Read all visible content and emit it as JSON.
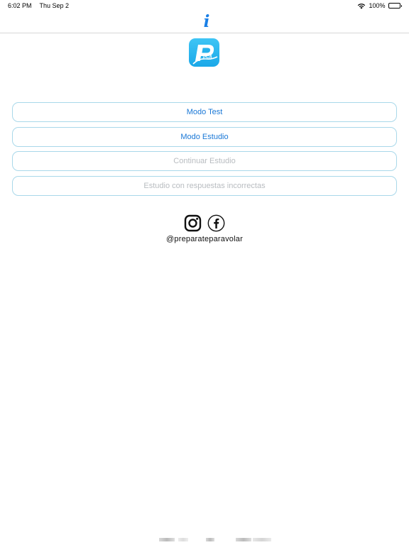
{
  "status_bar": {
    "time": "6:02 PM",
    "date": "Thu Sep 2",
    "battery_percent": "100%",
    "battery_level": 1.0,
    "icons": [
      "wifi-icon",
      "battery-icon"
    ]
  },
  "nav": {
    "info_glyph": "i",
    "info_icon": "info-icon",
    "accent_color": "#1a7fe6"
  },
  "logo": {
    "text": "PCA",
    "icon": "app-logo",
    "color": "#27b4ee"
  },
  "menu": {
    "items": [
      {
        "label": "Modo Test",
        "enabled": true
      },
      {
        "label": "Modo Estudio",
        "enabled": true
      },
      {
        "label": "Continuar Estudio",
        "enabled": false
      },
      {
        "label": "Estudio con respuestas incorrectas",
        "enabled": false
      }
    ],
    "enabled_color": "#1a78d6",
    "disabled_color": "#b8bcc0",
    "border_color": "#a9d8ea"
  },
  "social": {
    "icons": [
      "instagram-icon",
      "facebook-icon"
    ],
    "handle": "@preparateparavolar"
  }
}
